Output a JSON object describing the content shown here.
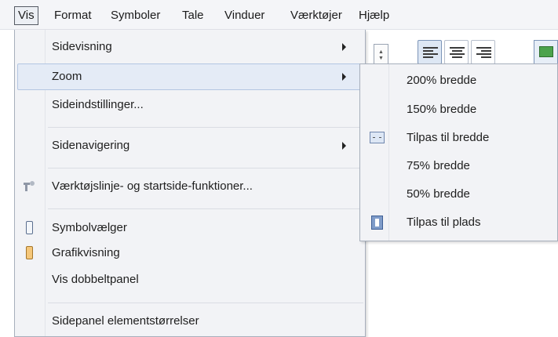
{
  "menubar": {
    "items": [
      {
        "label": "Vis",
        "active": true
      },
      {
        "label": "Format"
      },
      {
        "label": "Symboler"
      },
      {
        "label": "Tale"
      },
      {
        "label": "Vinduer"
      },
      {
        "label": "Værktøjer"
      },
      {
        "label": "Hjælp"
      }
    ]
  },
  "toolbar": {
    "icons": [
      "spinner-icon",
      "align-left-icon",
      "align-center-icon",
      "align-right-icon",
      "image-icon"
    ]
  },
  "vis_menu": {
    "items": [
      {
        "label": "Sidevisning",
        "submenu": true
      },
      {
        "label": "Zoom",
        "submenu": true,
        "highlighted": true
      },
      {
        "label": "Sideindstillinger..."
      },
      {
        "label": "Sidenavigering",
        "submenu": true
      },
      {
        "label": "Værktøjslinje- og  startside-funktioner...",
        "icon": "wrench-icon"
      },
      {
        "label": "Symbolvælger",
        "icon": "symbol-picker-icon"
      },
      {
        "label": "Grafikvisning",
        "icon": "graphics-view-icon"
      },
      {
        "label": "Vis dobbeltpanel"
      },
      {
        "label": "Sidepanel elementstørrelser"
      }
    ]
  },
  "zoom_menu": {
    "items": [
      {
        "label": "200% bredde"
      },
      {
        "label": "150% bredde"
      },
      {
        "label": "Tilpas til bredde",
        "icon": "fit-width-icon"
      },
      {
        "label": "75% bredde"
      },
      {
        "label": "50% bredde"
      },
      {
        "label": "Tilpas til plads",
        "icon": "fit-page-icon"
      }
    ]
  }
}
